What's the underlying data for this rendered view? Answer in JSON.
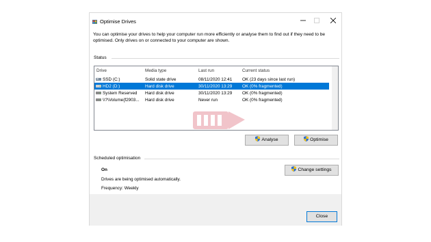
{
  "window": {
    "title": "Optimise Drives",
    "description": "You can optimise your drives to help your computer run more efficiently or analyse them to find out if they need to be optimised. Only drives on or connected to your computer are shown."
  },
  "status": {
    "label": "Status",
    "columns": [
      "Drive",
      "Media type",
      "Last run",
      "Current status"
    ],
    "rows": [
      {
        "drive": "SSD (C:)",
        "media": "Solid state drive",
        "last_run": "08/11/2020 12:41",
        "status": "OK (23 days since last run)",
        "icon": "ssd-drive-icon"
      },
      {
        "drive": "HD2 (D:)",
        "media": "Hard disk drive",
        "last_run": "30/11/2020 13:29",
        "status": "OK (0% fragmented)",
        "icon": "hard-drive-icon"
      },
      {
        "drive": "System Reserved",
        "media": "Hard disk drive",
        "last_run": "30/11/2020 13:29",
        "status": "OK (0% fragmented)",
        "icon": "hard-drive-icon"
      },
      {
        "drive": "\\\\?\\Volume{f2903...",
        "media": "Hard disk drive",
        "last_run": "Never run",
        "status": "OK (0% fragmented)",
        "icon": "hard-drive-icon"
      }
    ],
    "selected_row": "HD2 (D:)"
  },
  "buttons": {
    "analyse": "Analyse",
    "optimise": "Optimise",
    "change_settings": "Change settings",
    "close": "Close"
  },
  "scheduled": {
    "label": "Scheduled optimisation",
    "state": "On",
    "description": "Drives are being optimised automatically.",
    "frequency": "Frequency: Weekly"
  },
  "colors": {
    "selection": "#0078d7",
    "footer": "#f0f0f0"
  }
}
